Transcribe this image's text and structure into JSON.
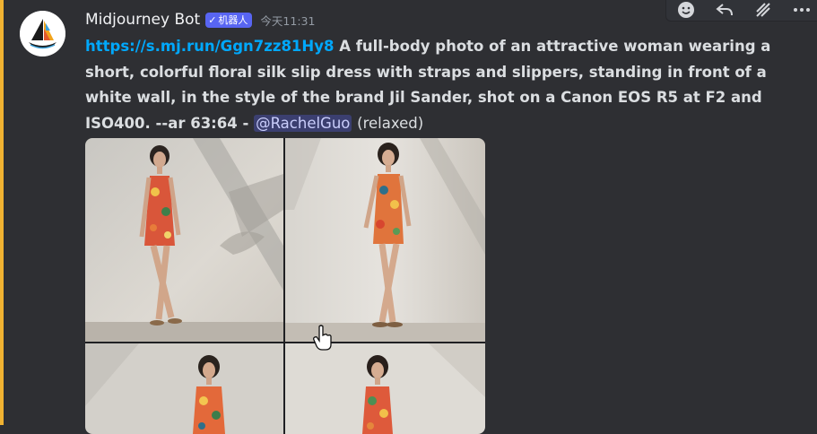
{
  "message": {
    "author": "Midjourney Bot",
    "bot_badge": "机器人",
    "timestamp": "今天11:31",
    "link": "https://s.mj.run/Ggn7zz81Hy8",
    "prompt": " A full-body photo of an attractive woman wearing a short, colorful floral silk slip dress with straps and slippers, standing in front of a white wall, in the style of the brand Jil Sander, shot on a Canon EOS R5 at F2 and ISO400. --ar 63:64 - ",
    "mention": "@RachelGuo",
    "mode": "(relaxed)"
  },
  "toolbar": {
    "items": [
      "add-reaction-icon",
      "reply-icon",
      "create-thread-icon",
      "more-icon"
    ]
  },
  "images": {
    "grid": [
      "image-1",
      "image-2",
      "image-3",
      "image-4"
    ]
  },
  "colors": {
    "accent": "#f0b232",
    "link": "#00a8fc",
    "badge": "#5865f2",
    "background": "#2e2f33"
  }
}
